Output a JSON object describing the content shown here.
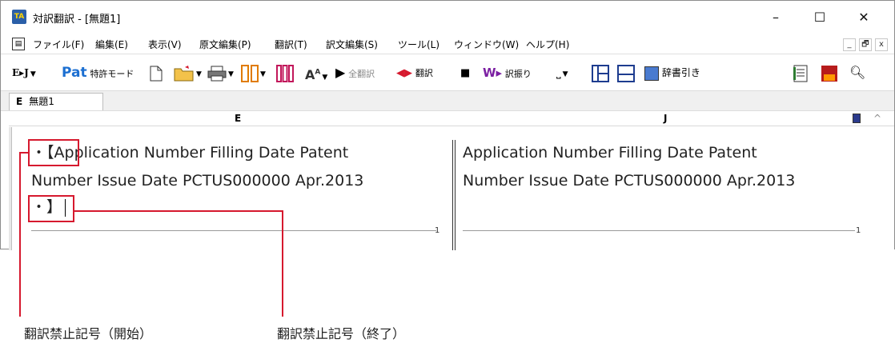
{
  "window": {
    "title": "対訳翻訳 - [無題1]",
    "app_icon_text": "TA",
    "controls": {
      "minimize": "–",
      "maximize": "☐",
      "close": "✕"
    }
  },
  "menu": {
    "items": [
      "ファイル(F)",
      "編集(E)",
      "表示(V)",
      "原文編集(P)",
      "翻訳(T)",
      "訳文編集(S)",
      "ツール(L)",
      "ウィンドウ(W)",
      "ヘルプ(H)"
    ],
    "mdi": {
      "minimize": "_",
      "restore": "🗗",
      "close": "x"
    }
  },
  "toolbar": {
    "ej_label": "E▸J",
    "pat_label": "Pat",
    "patent_mode": "特許モード",
    "translate_all": "全翻訳",
    "translate": "翻訳",
    "assign": "訳振り",
    "dictionary_lookup": "辞書引き"
  },
  "tab": {
    "lang": "E",
    "name": "無題1"
  },
  "columns": {
    "source": "E",
    "target": "J"
  },
  "source_pane": {
    "line1_marker": "・【",
    "line1_text": "Application Number Filling Date Patent",
    "line2_text": "Number Issue Date PCTUS000000 Apr.2013",
    "line3_marker": "・】",
    "line_number": "1"
  },
  "target_pane": {
    "line1_text": "Application Number Filling Date Patent",
    "line2_text": "Number Issue Date PCTUS000000 Apr.2013",
    "line_number": "1"
  },
  "annotations": {
    "start_label": "翻訳禁止記号（開始）",
    "end_label": "翻訳禁止記号（終了）",
    "color": "#d6192e"
  }
}
